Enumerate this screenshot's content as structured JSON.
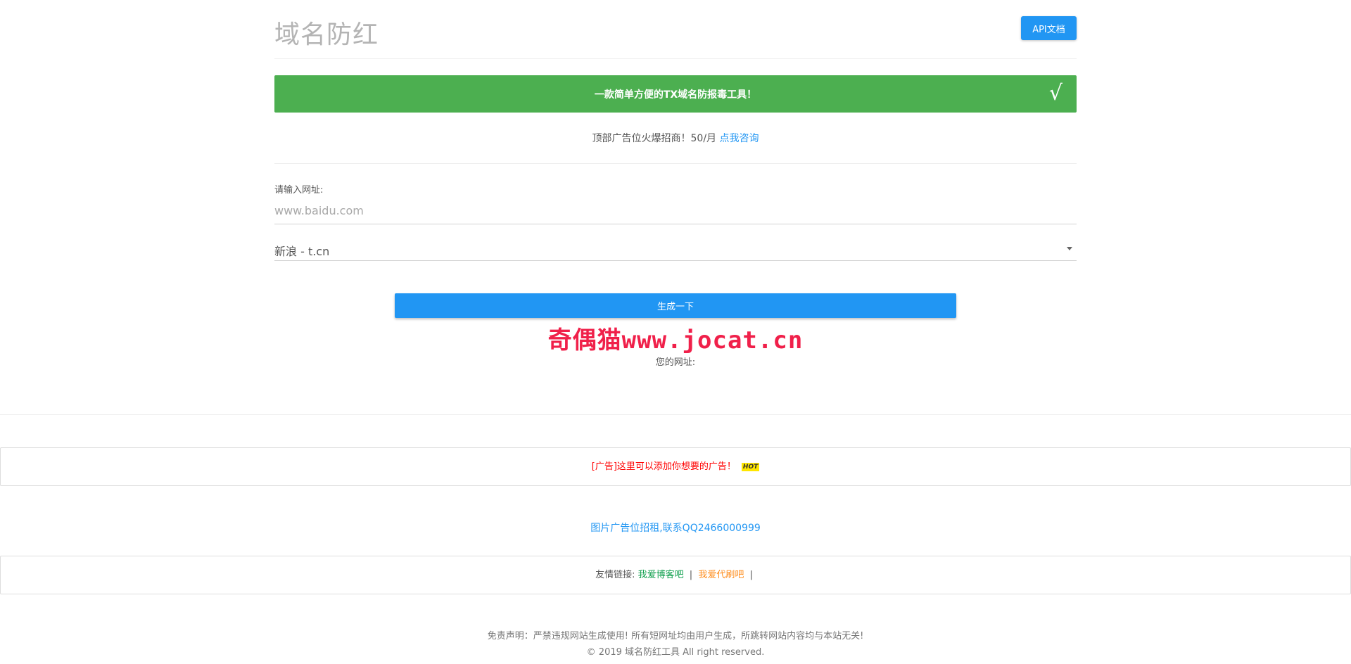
{
  "header": {
    "title": "域名防红",
    "api_button_label": "API文档"
  },
  "banner": {
    "text": "一款简单方便的TX域名防报毒工具！",
    "check_glyph": "√"
  },
  "top_ad": {
    "text": "顶部广告位火爆招商！50/月",
    "link_label": "点我咨询"
  },
  "form": {
    "url_label": "请输入网址:",
    "url_placeholder": "www.baidu.com",
    "url_value": "",
    "shortener_selected": "新浪 - t.cn"
  },
  "generate_button_label": "生成一下",
  "watermark_text": "奇偶猫www.jocat.cn",
  "result_label": "您的网址:",
  "ad_box": {
    "text": "[广告]这里可以添加你想要的广告！",
    "badge": "HOT"
  },
  "image_ad_text": "图片广告位招租,联系QQ2466000999",
  "friend_links": {
    "label": "友情链接:",
    "links": [
      {
        "label": "我爱博客吧",
        "color": "#0b9e4a"
      },
      {
        "label": "我爱代刷吧",
        "color": "#ff8c1a"
      }
    ],
    "separator": "|"
  },
  "footer": {
    "disclaimer": "免责声明：严禁违规网站生成使用! 所有短网址均由用户生成，所跳转网站内容均与本站无关!",
    "copyright": "© 2019 域名防红工具 All right reserved."
  },
  "colors": {
    "primary": "#2196f3",
    "success": "#4caf50",
    "danger": "#ff0000"
  }
}
